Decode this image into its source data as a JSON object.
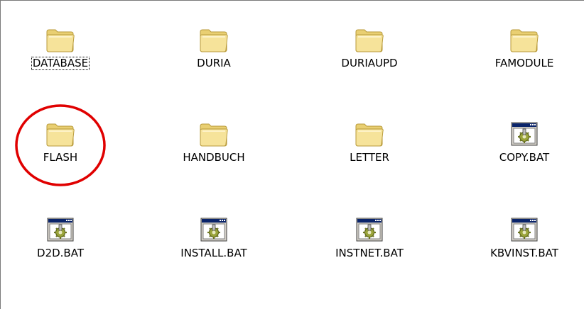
{
  "items": [
    {
      "label": "DATABASE",
      "type": "folder",
      "icon": "folder-icon",
      "focused": true
    },
    {
      "label": "DURIA",
      "type": "folder",
      "icon": "folder-icon",
      "focused": false
    },
    {
      "label": "DURIAUPD",
      "type": "folder",
      "icon": "folder-icon",
      "focused": false
    },
    {
      "label": "FAMODULE",
      "type": "folder",
      "icon": "folder-icon",
      "focused": false
    },
    {
      "label": "FLASH",
      "type": "folder",
      "icon": "folder-icon",
      "focused": false,
      "circled": true
    },
    {
      "label": "HANDBUCH",
      "type": "folder",
      "icon": "folder-icon",
      "focused": false
    },
    {
      "label": "LETTER",
      "type": "folder",
      "icon": "folder-icon",
      "focused": false
    },
    {
      "label": "COPY.BAT",
      "type": "batch",
      "icon": "batch-file-icon",
      "focused": false
    },
    {
      "label": "D2D.BAT",
      "type": "batch",
      "icon": "batch-file-icon",
      "focused": false
    },
    {
      "label": "INSTALL.BAT",
      "type": "batch",
      "icon": "batch-file-icon",
      "focused": false
    },
    {
      "label": "INSTNET.BAT",
      "type": "batch",
      "icon": "batch-file-icon",
      "focused": false
    },
    {
      "label": "KBVINST.BAT",
      "type": "batch",
      "icon": "batch-file-icon",
      "focused": false
    }
  ],
  "colors": {
    "annotation": "#e00000",
    "folder_fill": "#f6e39a",
    "folder_stroke": "#b89a3a"
  }
}
